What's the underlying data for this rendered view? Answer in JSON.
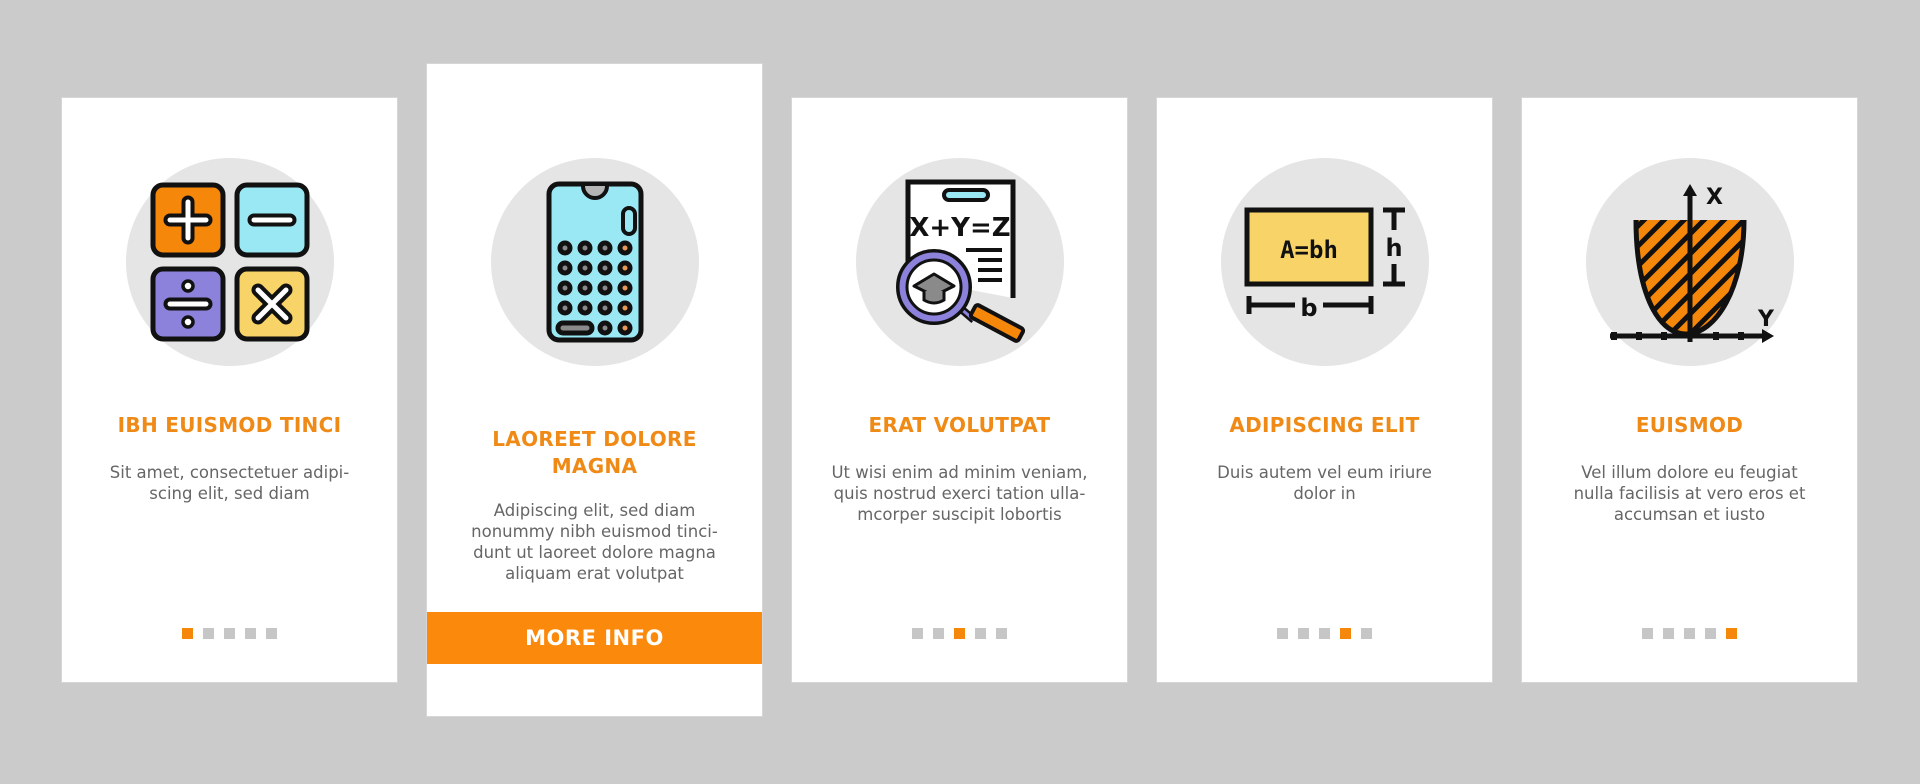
{
  "colors": {
    "background": "#cbcbcb",
    "card": "#ffffff",
    "accent": "#f5870a",
    "title": "#ef8a16",
    "text": "#666666",
    "dot_inactive": "#c6c6c6"
  },
  "cards": [
    {
      "icon": "calculator-operators-icon",
      "title": "IBH EUISMOD TINCI",
      "description": "Sit amet, consectetuer adipi-scing elit, sed diam",
      "description_lines": [
        "Sit amet, consectetuer adipi-",
        "scing elit, sed diam"
      ],
      "page_indicator": {
        "total": 5,
        "active": 1
      }
    },
    {
      "icon": "smartphone-calculator-icon",
      "title_lines": [
        "LAOREET DOLORE",
        "MAGNA"
      ],
      "description_lines": [
        "Adipiscing elit, sed diam",
        "nonummy nibh euismod tinci-",
        "dunt ut laoreet dolore magna",
        "aliquam erat volutpat"
      ],
      "button_label": "MORE INFO"
    },
    {
      "icon": "equation-search-icon",
      "title": "ERAT VOLUTPAT",
      "description_lines": [
        "Ut wisi enim ad minim veniam,",
        "quis nostrud exerci tation ulla-",
        "mcorper suscipit lobortis"
      ],
      "icon_text": "X+Y=Z",
      "page_indicator": {
        "total": 5,
        "active": 3
      }
    },
    {
      "icon": "area-formula-icon",
      "title": "ADIPISCING ELIT",
      "description_lines": [
        "Duis autem vel eum iriure",
        "dolor in"
      ],
      "icon_text": {
        "formula": "A=bh",
        "height_label": "h",
        "base_label": "b"
      },
      "page_indicator": {
        "total": 5,
        "active": 4
      }
    },
    {
      "icon": "parabola-graph-icon",
      "title": "EUISMOD",
      "description_lines": [
        "Vel illum dolore eu feugiat",
        "nulla facilisis at vero eros et",
        "accumsan et iusto"
      ],
      "icon_text": {
        "x_axis": "X",
        "y_axis": "Y"
      },
      "page_indicator": {
        "total": 5,
        "active": 5
      }
    }
  ]
}
